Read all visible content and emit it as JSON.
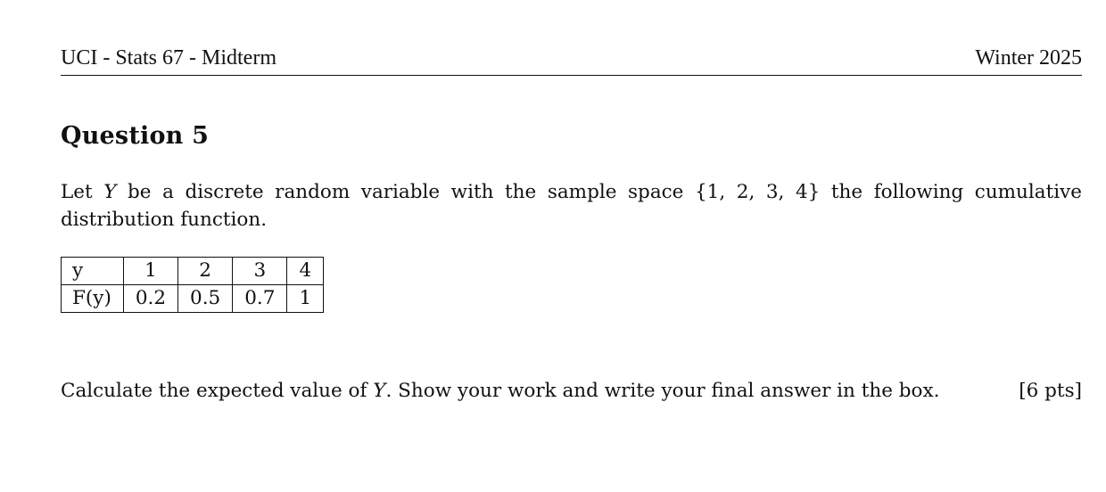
{
  "header": {
    "course": "UCI - Stats 67 - Midterm",
    "term": "Winter 2025"
  },
  "question": {
    "title": "Question 5",
    "intro_line1_a": "Let ",
    "intro_var": "Y",
    "intro_line1_b": " be a discrete random variable with the sample space {1, 2, 3, 4} the following cumulative",
    "intro_line2": "distribution function."
  },
  "cdf_table": {
    "row1": [
      "y",
      "1",
      "2",
      "3",
      "4"
    ],
    "row2": [
      "F(y)",
      "0.2",
      "0.5",
      "0.7",
      "1"
    ]
  },
  "prompt": {
    "text_a": "Calculate the expected value of ",
    "var": "Y",
    "text_b": ". Show your work and write your final answer in the box.",
    "points": "[6 pts]"
  }
}
